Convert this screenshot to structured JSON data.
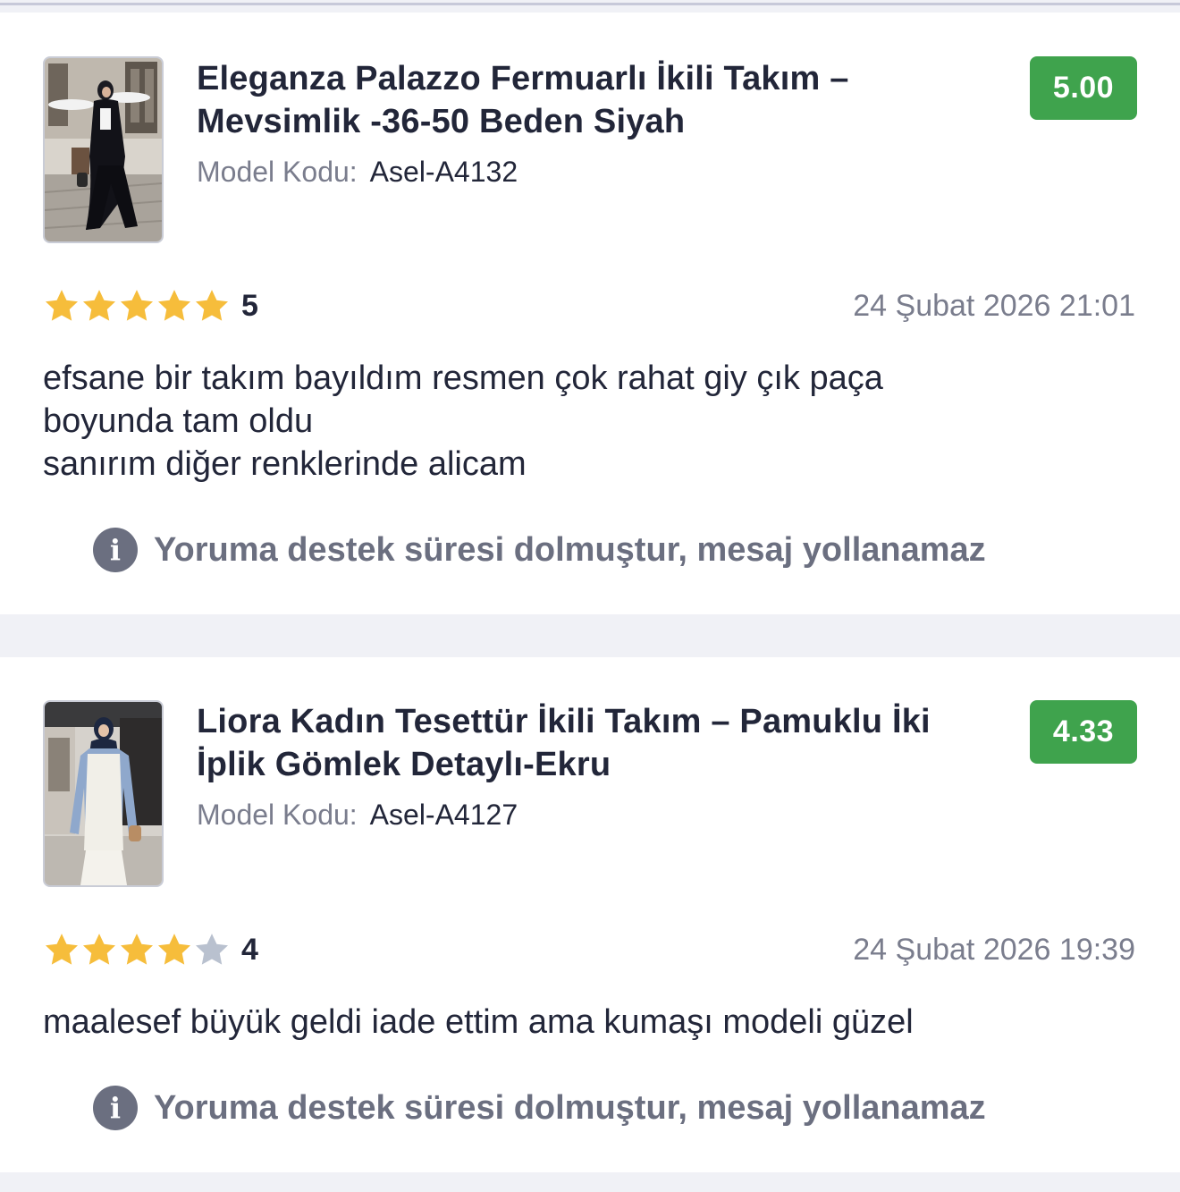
{
  "reviews": [
    {
      "product_title": "Eleganza Palazzo Fermuarlı İkili Takım – Mevsimlik -36-50 Beden Siyah",
      "model_label": "Model Kodu:",
      "model_code": "Asel-A4132",
      "score": "5.00",
      "rating": "5",
      "stars_filled": 5,
      "stars_total": 5,
      "date": "24 Şubat 2026 21:01",
      "comment": "efsane bir takım bayıldım resmen çok rahat giy çık paça\nboyunda tam oldu\nsanırım diğer renklerinde alicam",
      "notice": "Yoruma destek süresi dolmuştur, mesaj yollanamaz",
      "notice_icon": "info-icon"
    },
    {
      "product_title": "Liora Kadın Tesettür İkili Takım – Pamuklu İki İplik Gömlek Detaylı-Ekru",
      "model_label": "Model Kodu:",
      "model_code": "Asel-A4127",
      "score": "4.33",
      "rating": "4",
      "stars_filled": 4,
      "stars_total": 5,
      "date": "24 Şubat 2026 19:39",
      "comment": "maalesef büyük geldi iade ettim ama kumaşı modeli güzel",
      "notice": "Yoruma destek süresi dolmuştur, mesaj yollanamaz",
      "notice_icon": "info-icon"
    }
  ],
  "colors": {
    "badge": "#3fa34d",
    "star_filled": "#f6bd3b",
    "star_empty": "#b9c1cf",
    "text_primary": "#222639",
    "text_muted": "#7a7d8d"
  }
}
